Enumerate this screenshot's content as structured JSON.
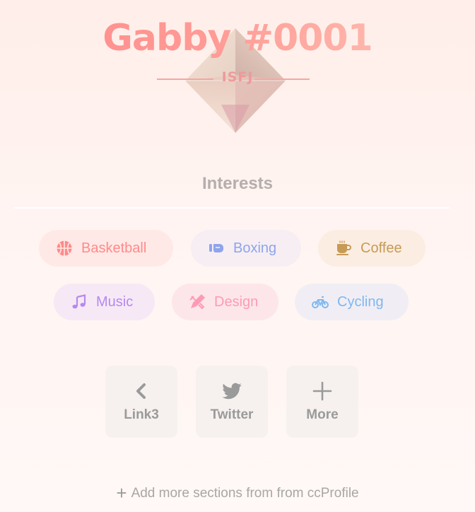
{
  "profile": {
    "name": "Gabby #0001",
    "mbti": "ISFJ"
  },
  "interests": {
    "title": "Interests",
    "items": [
      {
        "label": "Basketball",
        "icon": "basketball-icon",
        "color": "#ff8a8a",
        "bg": "#ffeae7"
      },
      {
        "label": "Boxing",
        "icon": "boxing-glove-icon",
        "color": "#8ea4ec",
        "bg": "#f5eef1"
      },
      {
        "label": "Coffee",
        "icon": "coffee-cup-icon",
        "color": "#c79a55",
        "bg": "#fbeee3"
      },
      {
        "label": "Music",
        "icon": "music-note-icon",
        "color": "#b788f0",
        "bg": "#f7e9f4"
      },
      {
        "label": "Design",
        "icon": "design-tools-icon",
        "color": "#ff9ab4",
        "bg": "#fde8ea"
      },
      {
        "label": "Cycling",
        "icon": "bicycle-icon",
        "color": "#7fb7f0",
        "bg": "#f6eef0"
      }
    ]
  },
  "links": [
    {
      "label": "Link3",
      "icon": "chevron-left-icon"
    },
    {
      "label": "Twitter",
      "icon": "twitter-icon"
    },
    {
      "label": "More",
      "icon": "plus-icon"
    }
  ],
  "footer": {
    "add_more": "Add more sections from from ccProfile"
  }
}
